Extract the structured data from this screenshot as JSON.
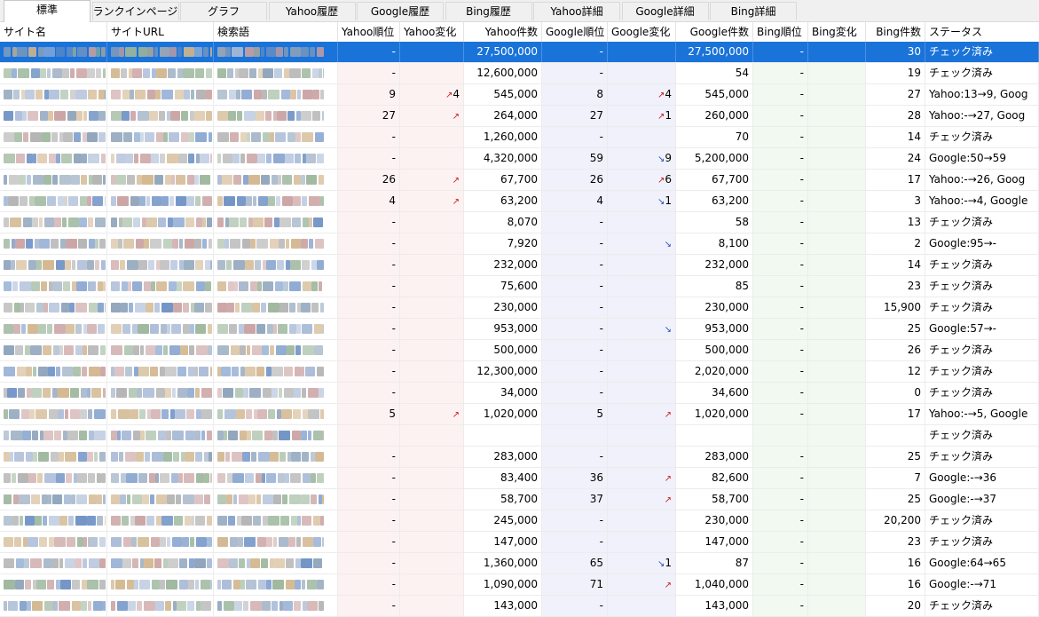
{
  "tabs": [
    "標準",
    "ランクインページ",
    "グラフ",
    "Yahoo履歴",
    "Google履歴",
    "Bing履歴",
    "Yahoo詳細",
    "Google詳細",
    "Bing詳細"
  ],
  "active_tab": 0,
  "columns": {
    "site_name": "サイト名",
    "site_url": "サイトURL",
    "keyword": "検索語",
    "yahoo_rank": "Yahoo順位",
    "yahoo_change": "Yahoo変化",
    "yahoo_count": "Yahoo件数",
    "google_rank": "Google順位",
    "google_change": "Google変化",
    "google_count": "Google件数",
    "bing_rank": "Bing順位",
    "bing_change": "Bing変化",
    "bing_count": "Bing件数",
    "status": "ステータス"
  },
  "colors": {
    "selection": "#1a73d9",
    "up_arrow": "#cc1e1e",
    "down_arrow": "#1f4fc0"
  },
  "rows": [
    {
      "yr": "-",
      "yc": "",
      "ycd": "",
      "yn": "27,500,000",
      "gr": "-",
      "gc": "",
      "gcd": "",
      "gn": "27,500,000",
      "br": "-",
      "bn": "30",
      "st": "チェック済み",
      "sel": true
    },
    {
      "yr": "-",
      "yc": "",
      "ycd": "",
      "yn": "12,600,000",
      "gr": "-",
      "gc": "",
      "gcd": "",
      "gn": "54",
      "br": "-",
      "bn": "19",
      "st": "チェック済み"
    },
    {
      "yr": "9",
      "yc": "4",
      "ycd": "up",
      "yn": "545,000",
      "gr": "8",
      "gc": "4",
      "gcd": "up",
      "gn": "545,000",
      "br": "-",
      "bn": "27",
      "st": "Yahoo:13→9, Goog"
    },
    {
      "yr": "27",
      "yc": "",
      "ycd": "up",
      "yn": "264,000",
      "gr": "27",
      "gc": "1",
      "gcd": "up",
      "gn": "260,000",
      "br": "-",
      "bn": "28",
      "st": "Yahoo:-→27, Goog"
    },
    {
      "yr": "-",
      "yc": "",
      "ycd": "",
      "yn": "1,260,000",
      "gr": "-",
      "gc": "",
      "gcd": "",
      "gn": "70",
      "br": "-",
      "bn": "14",
      "st": "チェック済み"
    },
    {
      "yr": "-",
      "yc": "",
      "ycd": "",
      "yn": "4,320,000",
      "gr": "59",
      "gc": "9",
      "gcd": "down",
      "gn": "5,200,000",
      "br": "-",
      "bn": "24",
      "st": "Google:50→59"
    },
    {
      "yr": "26",
      "yc": "",
      "ycd": "up",
      "yn": "67,700",
      "gr": "26",
      "gc": "6",
      "gcd": "up",
      "gn": "67,700",
      "br": "-",
      "bn": "17",
      "st": "Yahoo:-→26, Goog"
    },
    {
      "yr": "4",
      "yc": "",
      "ycd": "up",
      "yn": "63,200",
      "gr": "4",
      "gc": "1",
      "gcd": "down",
      "gn": "63,200",
      "br": "-",
      "bn": "3",
      "st": "Yahoo:-→4, Google"
    },
    {
      "yr": "-",
      "yc": "",
      "ycd": "",
      "yn": "8,070",
      "gr": "-",
      "gc": "",
      "gcd": "",
      "gn": "58",
      "br": "-",
      "bn": "13",
      "st": "チェック済み"
    },
    {
      "yr": "-",
      "yc": "",
      "ycd": "",
      "yn": "7,920",
      "gr": "-",
      "gc": "",
      "gcd": "down",
      "gn": "8,100",
      "br": "-",
      "bn": "2",
      "st": "Google:95→-"
    },
    {
      "yr": "-",
      "yc": "",
      "ycd": "",
      "yn": "232,000",
      "gr": "-",
      "gc": "",
      "gcd": "",
      "gn": "232,000",
      "br": "-",
      "bn": "14",
      "st": "チェック済み"
    },
    {
      "yr": "-",
      "yc": "",
      "ycd": "",
      "yn": "75,600",
      "gr": "-",
      "gc": "",
      "gcd": "",
      "gn": "85",
      "br": "-",
      "bn": "23",
      "st": "チェック済み"
    },
    {
      "yr": "-",
      "yc": "",
      "ycd": "",
      "yn": "230,000",
      "gr": "-",
      "gc": "",
      "gcd": "",
      "gn": "230,000",
      "br": "-",
      "bn": "15,900",
      "st": "チェック済み"
    },
    {
      "yr": "-",
      "yc": "",
      "ycd": "",
      "yn": "953,000",
      "gr": "-",
      "gc": "",
      "gcd": "down",
      "gn": "953,000",
      "br": "-",
      "bn": "25",
      "st": "Google:57→-"
    },
    {
      "yr": "-",
      "yc": "",
      "ycd": "",
      "yn": "500,000",
      "gr": "-",
      "gc": "",
      "gcd": "",
      "gn": "500,000",
      "br": "-",
      "bn": "26",
      "st": "チェック済み"
    },
    {
      "yr": "-",
      "yc": "",
      "ycd": "",
      "yn": "12,300,000",
      "gr": "-",
      "gc": "",
      "gcd": "",
      "gn": "2,020,000",
      "br": "-",
      "bn": "12",
      "st": "チェック済み"
    },
    {
      "yr": "-",
      "yc": "",
      "ycd": "",
      "yn": "34,000",
      "gr": "-",
      "gc": "",
      "gcd": "",
      "gn": "34,600",
      "br": "-",
      "bn": "0",
      "st": "チェック済み"
    },
    {
      "yr": "5",
      "yc": "",
      "ycd": "up",
      "yn": "1,020,000",
      "gr": "5",
      "gc": "",
      "gcd": "up",
      "gn": "1,020,000",
      "br": "-",
      "bn": "17",
      "st": "Yahoo:-→5, Google"
    },
    {
      "yr": "",
      "yc": "",
      "ycd": "",
      "yn": "",
      "gr": "",
      "gc": "",
      "gcd": "",
      "gn": "",
      "br": "",
      "bn": "",
      "st": "チェック済み"
    },
    {
      "yr": "-",
      "yc": "",
      "ycd": "",
      "yn": "283,000",
      "gr": "-",
      "gc": "",
      "gcd": "",
      "gn": "283,000",
      "br": "-",
      "bn": "25",
      "st": "チェック済み"
    },
    {
      "yr": "-",
      "yc": "",
      "ycd": "",
      "yn": "83,400",
      "gr": "36",
      "gc": "",
      "gcd": "up",
      "gn": "82,600",
      "br": "-",
      "bn": "7",
      "st": "Google:-→36"
    },
    {
      "yr": "-",
      "yc": "",
      "ycd": "",
      "yn": "58,700",
      "gr": "37",
      "gc": "",
      "gcd": "up",
      "gn": "58,700",
      "br": "-",
      "bn": "25",
      "st": "Google:-→37"
    },
    {
      "yr": "-",
      "yc": "",
      "ycd": "",
      "yn": "245,000",
      "gr": "-",
      "gc": "",
      "gcd": "",
      "gn": "230,000",
      "br": "-",
      "bn": "20,200",
      "st": "チェック済み"
    },
    {
      "yr": "-",
      "yc": "",
      "ycd": "",
      "yn": "147,000",
      "gr": "-",
      "gc": "",
      "gcd": "",
      "gn": "147,000",
      "br": "-",
      "bn": "23",
      "st": "チェック済み"
    },
    {
      "yr": "-",
      "yc": "",
      "ycd": "",
      "yn": "1,360,000",
      "gr": "65",
      "gc": "1",
      "gcd": "down",
      "gn": "87",
      "br": "-",
      "bn": "16",
      "st": "Google:64→65"
    },
    {
      "yr": "-",
      "yc": "",
      "ycd": "",
      "yn": "1,090,000",
      "gr": "71",
      "gc": "",
      "gcd": "up",
      "gn": "1,040,000",
      "br": "-",
      "bn": "16",
      "st": "Google:-→71"
    },
    {
      "yr": "-",
      "yc": "",
      "ycd": "",
      "yn": "143,000",
      "gr": "-",
      "gc": "",
      "gcd": "",
      "gn": "143,000",
      "br": "-",
      "bn": "20",
      "st": "チェック済み"
    }
  ]
}
